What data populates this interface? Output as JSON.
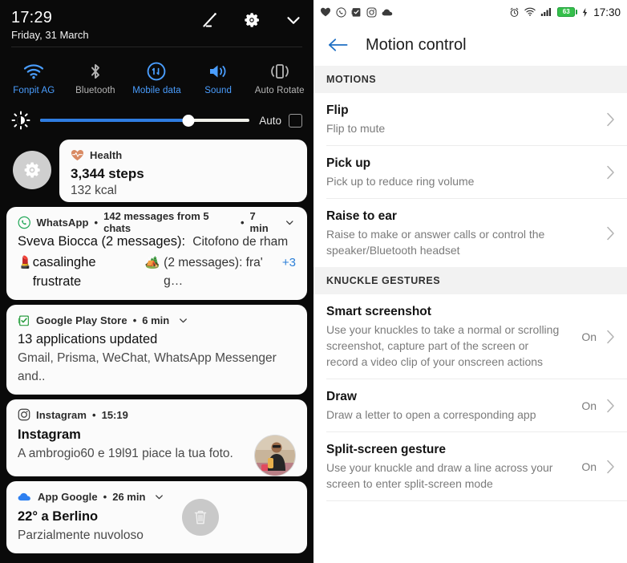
{
  "shade": {
    "clock": {
      "time": "17:29",
      "date": "Friday, 31 March"
    },
    "header_icons": [
      {
        "name": "edit-pencil-icon",
        "label": "Edit"
      },
      {
        "name": "settings-gear-icon",
        "label": "Settings"
      },
      {
        "name": "chevron-down-icon",
        "label": "Collapse"
      }
    ],
    "quick_tiles": [
      {
        "label": "Fonpit AG",
        "icon": "wifi-icon",
        "state": "on"
      },
      {
        "label": "Bluetooth",
        "icon": "bluetooth-icon",
        "state": "off"
      },
      {
        "label": "Mobile data",
        "icon": "mobile-data-icon",
        "state": "on"
      },
      {
        "label": "Sound",
        "icon": "sound-icon",
        "state": "on"
      },
      {
        "label": "Auto Rotate",
        "icon": "auto-rotate-icon",
        "state": "off"
      }
    ],
    "brightness": {
      "icon": "brightness-icon",
      "value_percent": 71,
      "auto_label": "Auto",
      "auto_checked": false
    },
    "accent_color": "#4a9eff",
    "slider_color": "#2f7de1",
    "health": {
      "app": "Health",
      "icon": "heart-pulse-icon",
      "steps": "3,344 steps",
      "calories": "132 kcal",
      "gear_icon": "settings-gear-icon"
    },
    "notifications": [
      {
        "icon": "whatsapp-icon",
        "app": "WhatsApp",
        "meta": "142 messages from 5 chats",
        "time": "7 min",
        "line1_bold": "Sveva Biocca (2 messages):",
        "line1_rest": "Citofono de rham",
        "line2_emoji1": "💄",
        "line2": "casalinghe frustrate",
        "line2_emoji2": "🏕️",
        "line2_rest": "(2 messages): fra' g…",
        "overflow": "+3"
      },
      {
        "icon": "play-store-icon",
        "app": "Google Play Store",
        "meta": "",
        "time": "6 min",
        "title": "13 applications updated",
        "body": "Gmail, Prisma, WeChat, WhatsApp Messenger and.."
      },
      {
        "icon": "instagram-icon",
        "app": "Instagram",
        "meta": "",
        "time": "15:19",
        "title": "Instagram",
        "body": "A ambrogio60 e 19l91 piace la tua foto.",
        "avatar": "user-photo-avatar"
      },
      {
        "icon": "google-weather-cloud-icon",
        "app": "App Google",
        "meta": "",
        "time": "26 min",
        "title": "22° a Berlino",
        "body": "Parzialmente nuvoloso",
        "action_icon": "trash-icon"
      }
    ]
  },
  "settings": {
    "statusbar": {
      "left_icons": [
        "heart-health-icon",
        "whatsapp-icon",
        "play-store-icon",
        "instagram-icon",
        "google-cloud-icon"
      ],
      "right_icons": [
        "alarm-icon",
        "wifi-icon",
        "signal-bars-icon"
      ],
      "battery_percent": "63",
      "battery_charging": true,
      "battery_color": "#35c04b",
      "time": "17:30"
    },
    "appbar": {
      "back_icon": "back-arrow-icon",
      "title": "Motion control",
      "back_color": "#1e6fc4"
    },
    "sections": [
      {
        "header": "MOTIONS",
        "rows": [
          {
            "title": "Flip",
            "desc": "Flip to mute",
            "value": "",
            "chevron": "chevron-right-icon"
          },
          {
            "title": "Pick up",
            "desc": "Pick up to reduce ring volume",
            "value": "",
            "chevron": "chevron-right-icon"
          },
          {
            "title": "Raise to ear",
            "desc": "Raise to make or answer calls or control the speaker/Bluetooth headset",
            "value": "",
            "chevron": "chevron-right-icon"
          }
        ]
      },
      {
        "header": "KNUCKLE GESTURES",
        "rows": [
          {
            "title": "Smart screenshot",
            "desc": "Use your knuckles to take a normal or scrolling screenshot, capture part of the screen or record a video clip of your onscreen actions",
            "value": "On",
            "chevron": "chevron-right-icon"
          },
          {
            "title": "Draw",
            "desc": "Draw a letter to open a corresponding app",
            "value": "On",
            "chevron": "chevron-right-icon"
          },
          {
            "title": "Split-screen gesture",
            "desc": "Use your knuckle and draw a line across your screen to enter split-screen mode",
            "value": "On",
            "chevron": "chevron-right-icon"
          }
        ]
      }
    ]
  }
}
